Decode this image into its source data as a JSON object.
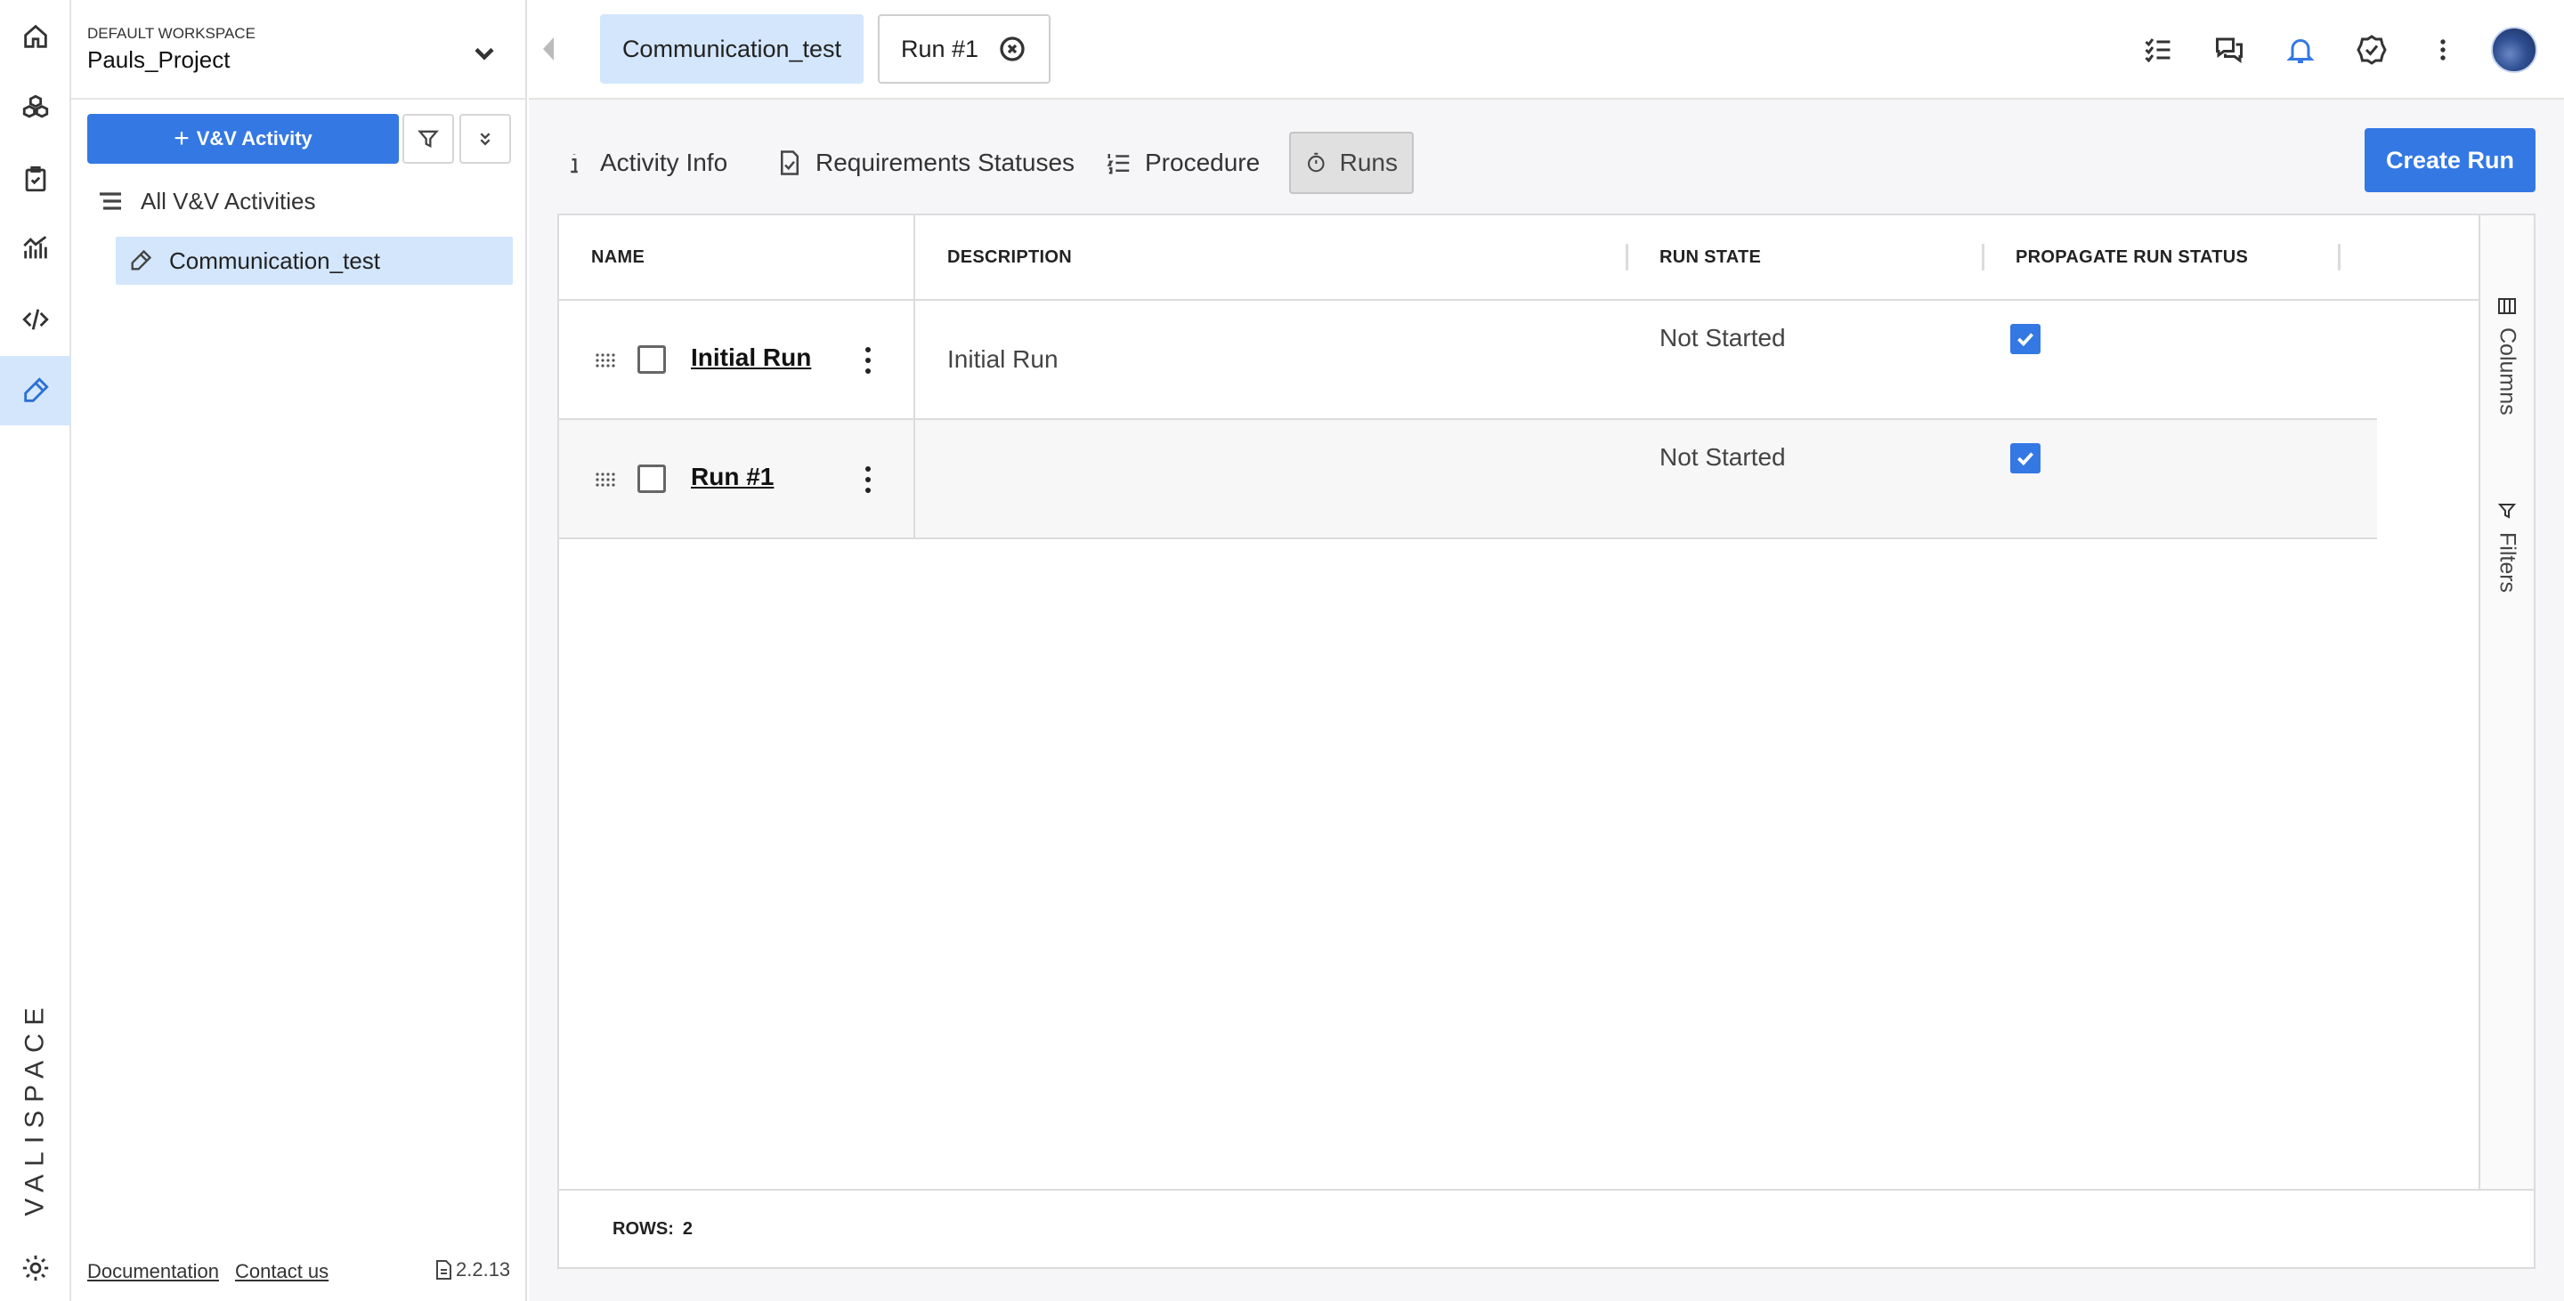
{
  "workspace": {
    "label": "DEFAULT WORKSPACE",
    "project": "Pauls_Project"
  },
  "sidebar": {
    "add_button": "V&V Activity",
    "add_button_prefix": "+",
    "tree_root": "All V&V Activities",
    "tree_items": [
      {
        "label": "Communication_test",
        "selected": true
      }
    ],
    "footer": {
      "documentation": "Documentation",
      "contact": "Contact us",
      "version": "2.2.13"
    }
  },
  "rail": {
    "brand": "VALISPACE",
    "items": [
      "home-icon",
      "components-icon",
      "requirements-icon",
      "analyses-icon",
      "scripting-icon",
      "verification-icon",
      "settings-icon"
    ],
    "active": "verification-icon"
  },
  "topbar": {
    "tabs": [
      {
        "label": "Communication_test",
        "active": true
      },
      {
        "label": "Run #1",
        "active": false,
        "closable": true
      }
    ],
    "icons": [
      "checklist-icon",
      "chat-icon",
      "bell-icon",
      "verified-icon",
      "more-vert-icon",
      "avatar"
    ]
  },
  "subtabs": [
    {
      "label": "Activity Info",
      "icon": "info-icon",
      "active": false
    },
    {
      "label": "Requirements Statuses",
      "icon": "doc-check-icon",
      "active": false
    },
    {
      "label": "Procedure",
      "icon": "numbered-list-icon",
      "active": false
    },
    {
      "label": "Runs",
      "icon": "timer-icon",
      "active": true
    }
  ],
  "create_button": "Create Run",
  "table": {
    "columns": [
      "NAME",
      "DESCRIPTION",
      "RUN STATE",
      "PROPAGATE RUN STATUS"
    ],
    "rows": [
      {
        "name": "Initial Run",
        "description": "Initial Run",
        "run_state": "Not Started",
        "propagate": true
      },
      {
        "name": "Run #1",
        "description": "",
        "run_state": "Not Started",
        "propagate": true
      }
    ],
    "side_panel": {
      "columns": "Columns",
      "filters": "Filters"
    },
    "footer": {
      "rows_label": "ROWS:",
      "rows_count": "2"
    }
  },
  "colors": {
    "accent": "#3478e4",
    "selected_bg": "#d3e6fb",
    "tab_active_bg": "#e0e0e0"
  }
}
